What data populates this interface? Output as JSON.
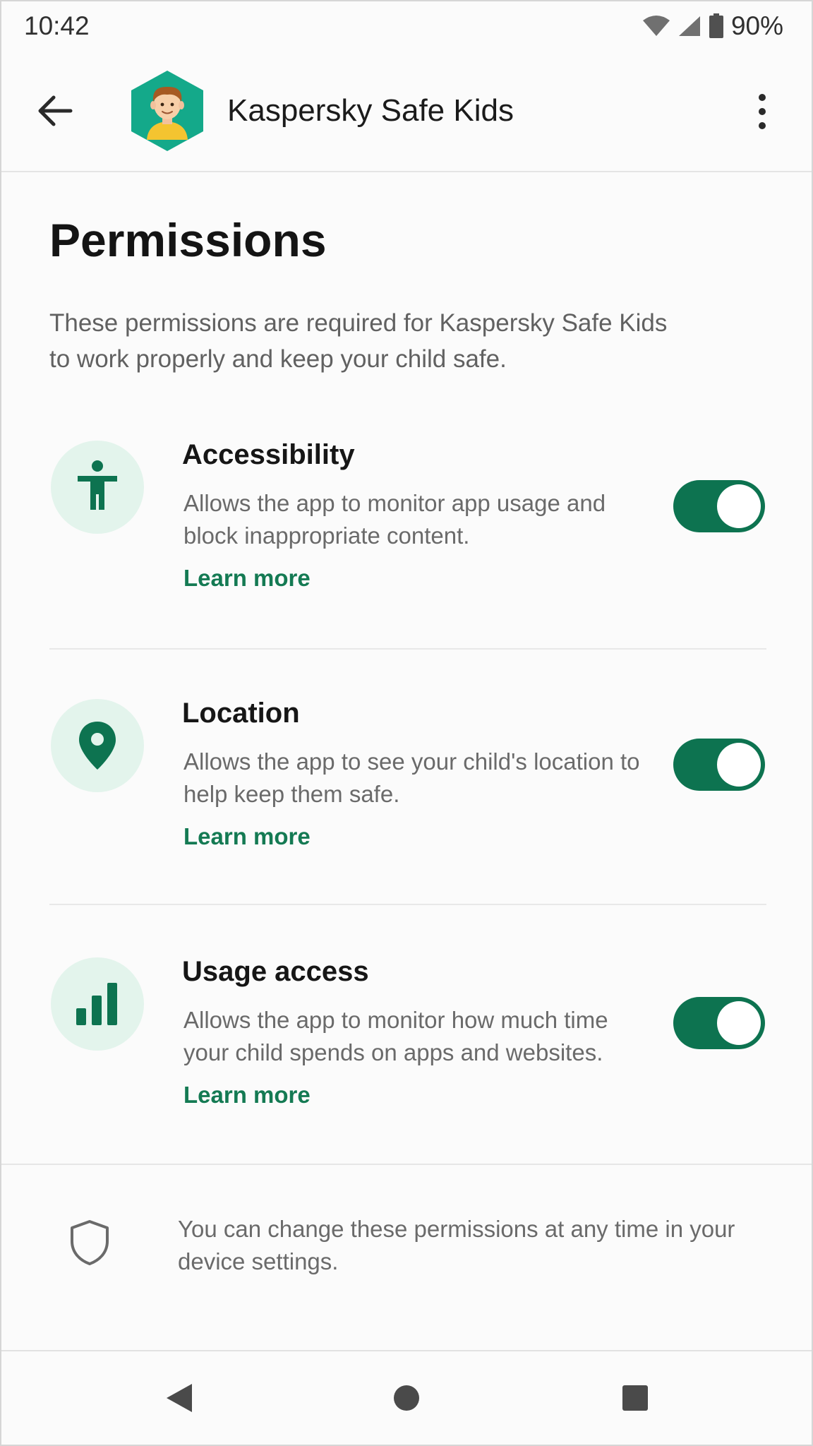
{
  "status_bar": {
    "time": "10:42",
    "battery": "90%",
    "icons": [
      "wifi-icon",
      "signal-icon",
      "battery-icon"
    ]
  },
  "app_bar": {
    "title": "Kaspersky Safe Kids",
    "icons": [
      "back-arrow-icon",
      "app-logo-icon",
      "more-vert-icon"
    ]
  },
  "page": {
    "title": "Permissions",
    "intro": "These permissions are required for Kaspersky Safe Kids to work properly and keep your child safe."
  },
  "permissions": [
    {
      "title": "Accessibility",
      "description": "Allows the app to monitor app usage and block inappropriate content.",
      "link": "Learn more",
      "enabled": true,
      "icon": "accessibility-icon"
    },
    {
      "title": "Location",
      "description": "Allows the app to see your child's location to help keep them safe.",
      "link": "Learn more",
      "enabled": true,
      "icon": "location-pin-icon"
    },
    {
      "title": "Usage access",
      "description": "Allows the app to monitor how much time your child spends on apps and websites.",
      "link": "Learn more",
      "enabled": true,
      "icon": "bar-chart-icon"
    }
  ],
  "footer_note": {
    "text": "You can change these permissions at any time in your device settings.",
    "icon": "shield-icon"
  },
  "nav_bar": {
    "icons": [
      "nav-back-icon",
      "nav-home-icon",
      "nav-recents-icon"
    ]
  },
  "colors": {
    "accent": "#0d7350",
    "accent_light": "#e3f4ec",
    "link": "#147a53",
    "logo_bg": "#14a98a"
  }
}
